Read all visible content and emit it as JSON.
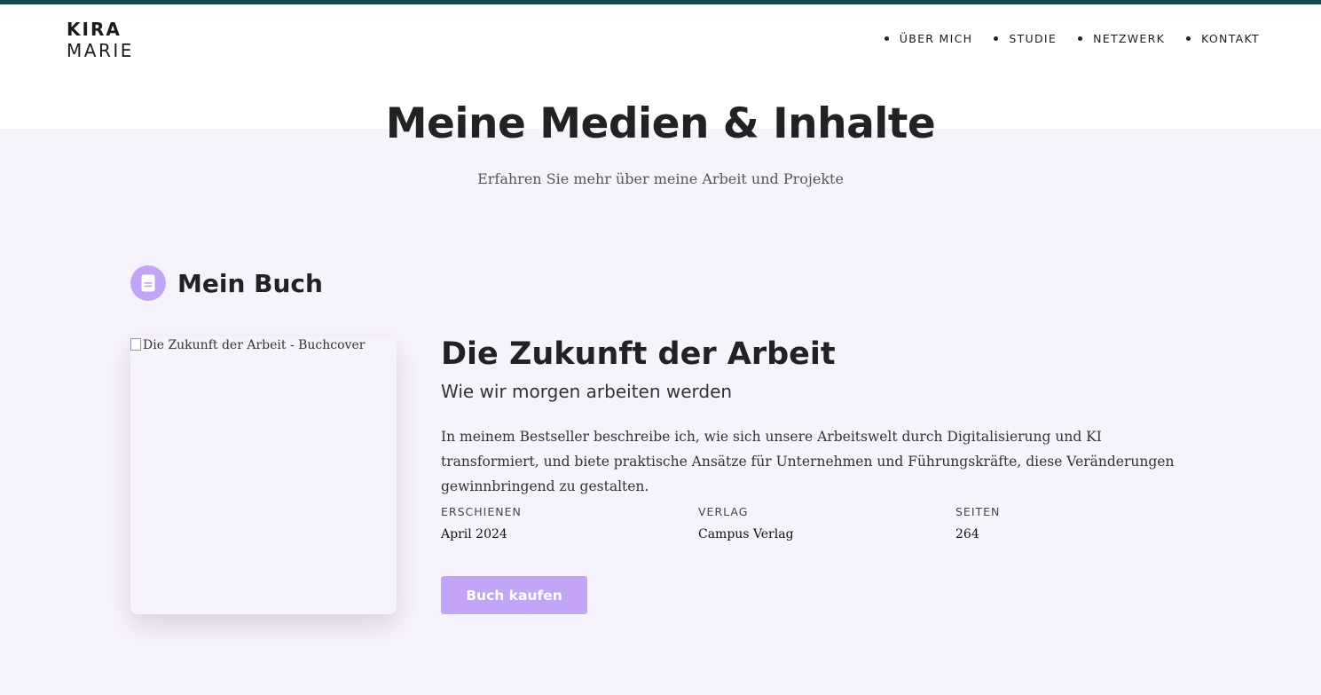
{
  "colors": {
    "accent": "#c4a4f6",
    "topbar": "#134a4f",
    "page_background": "#f7f3fd",
    "header_background": "#ffffff",
    "text": "#222222"
  },
  "logo": {
    "first": "KIRA",
    "last": "MARIE"
  },
  "nav": {
    "items": [
      {
        "label": "ÜBER MICH"
      },
      {
        "label": "STUDIE"
      },
      {
        "label": "NETZWERK"
      },
      {
        "label": "KONTAKT"
      }
    ]
  },
  "hero": {
    "title": "Meine Medien & Inhalte",
    "subtitle": "Erfahren Sie mehr über meine Arbeit und Projekte"
  },
  "book_section": {
    "heading": "Mein Buch",
    "icon": "book-icon",
    "cover_alt": "Die Zukunft der Arbeit - Buchcover",
    "title": "Die Zukunft der Arbeit",
    "subtitle": "Wie wir morgen arbeiten werden",
    "description": "In meinem Bestseller beschreibe ich, wie sich unsere Arbeitswelt durch Digitalisierung und KI transformiert, und biete praktische Ansätze für Unternehmen und Führungskräfte, diese Veränderungen gewinnbringend zu gestalten.",
    "meta": [
      {
        "label": "ERSCHIENEN",
        "value": "April 2024"
      },
      {
        "label": "VERLAG",
        "value": "Campus Verlag"
      },
      {
        "label": "SEITEN",
        "value": "264"
      }
    ],
    "button_label": "Buch kaufen"
  }
}
